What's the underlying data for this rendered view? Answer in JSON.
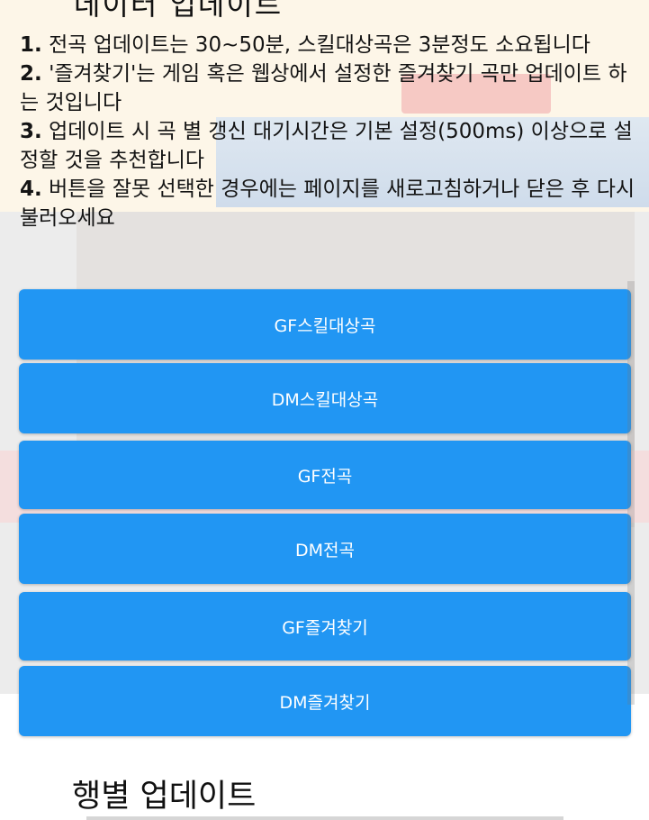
{
  "header": {
    "cut_title": "데이터 업데이트"
  },
  "notes": [
    {
      "num": "1.",
      "text": "전곡 업데이트는 30~50분, 스킬대상곡은 3분정도 소요됩니다"
    },
    {
      "num": "2.",
      "text": "'즐겨찾기'는 게임 혹은 웹상에서 설정한 즐겨찾기 곡만 업데이트 하는 것입니다"
    },
    {
      "num": "3.",
      "text": "업데이트 시 곡 별 갱신 대기시간은 기본 설정(500ms) 이상으로 설정할 것을 추천합니다"
    },
    {
      "num": "4.",
      "text": "버튼을 잘못 선택한 경우에는 페이지를 새로고침하거나 닫은 후 다시 불러오세요"
    }
  ],
  "buttons": {
    "gf_skill": "GF스킬대상곡",
    "dm_skill": "DM스킬대상곡",
    "gf_all": "GF전곡",
    "dm_all": "DM전곡",
    "gf_fav": "GF즐겨찾기",
    "dm_fav": "DM즐겨찾기"
  },
  "section": {
    "title": "행별 업데이트"
  },
  "colors": {
    "button_bg": "#2196f3",
    "button_text": "#ffffff",
    "text": "#141414"
  }
}
